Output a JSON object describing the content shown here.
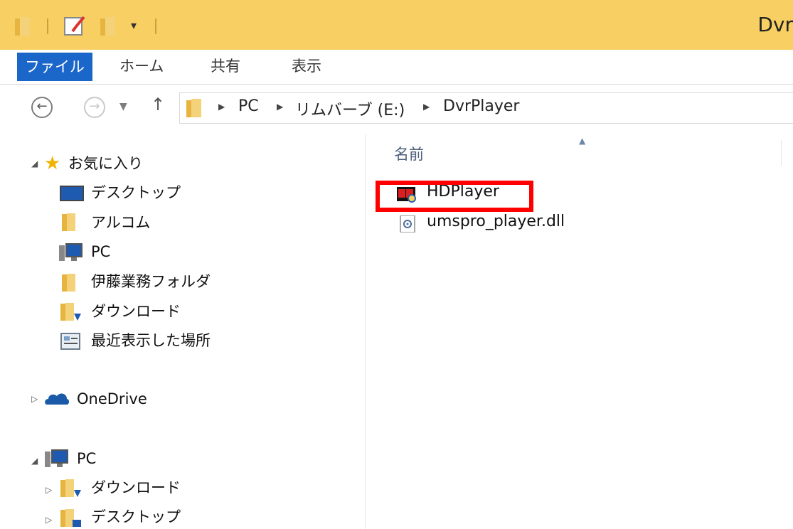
{
  "window": {
    "title": "Dvr"
  },
  "ribbon": {
    "tabs": [
      {
        "label": "ファイル",
        "active": true
      },
      {
        "label": "ホーム"
      },
      {
        "label": "共有"
      },
      {
        "label": "表示"
      }
    ]
  },
  "navigation": {
    "back_icon": "back-arrow-icon",
    "forward_icon": "forward-arrow-icon",
    "recent_icon": "chevron-down-icon",
    "up_icon": "up-arrow-icon",
    "breadcrumbs": [
      "PC",
      "リムバーブ (E:)",
      "DvrPlayer"
    ]
  },
  "sidebar": {
    "favorites": {
      "label": "お気に入り",
      "items": [
        {
          "label": "デスクトップ",
          "icon": "desktop-icon"
        },
        {
          "label": "アルコム",
          "icon": "folder-icon"
        },
        {
          "label": "PC",
          "icon": "computer-icon"
        },
        {
          "label": "伊藤業務フォルダ",
          "icon": "folder-icon"
        },
        {
          "label": "ダウンロード",
          "icon": "download-folder-icon"
        },
        {
          "label": "最近表示した場所",
          "icon": "recent-places-icon"
        }
      ]
    },
    "onedrive": {
      "label": "OneDrive"
    },
    "pc": {
      "label": "PC",
      "items": [
        {
          "label": "ダウンロード",
          "icon": "download-folder-icon"
        },
        {
          "label": "デスクトップ",
          "icon": "desktop-folder-icon"
        }
      ]
    }
  },
  "file_list": {
    "column_header": "名前",
    "files": [
      {
        "name": "HDPlayer",
        "icon": "hdplayer-app-icon",
        "highlighted": true
      },
      {
        "name": "umspro_player.dll",
        "icon": "dll-file-icon"
      }
    ]
  },
  "colors": {
    "titlebar": "#f7cf62",
    "file_tab": "#1a66c9",
    "highlight": "#ff0000"
  }
}
